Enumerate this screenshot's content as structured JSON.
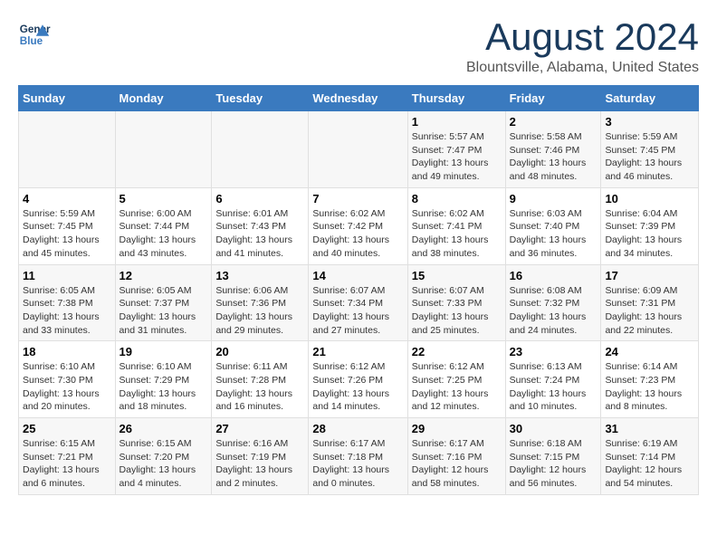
{
  "header": {
    "logo_line1": "General",
    "logo_line2": "Blue",
    "main_title": "August 2024",
    "subtitle": "Blountsville, Alabama, United States"
  },
  "days_of_week": [
    "Sunday",
    "Monday",
    "Tuesday",
    "Wednesday",
    "Thursday",
    "Friday",
    "Saturday"
  ],
  "weeks": [
    [
      {
        "day": "",
        "info": ""
      },
      {
        "day": "",
        "info": ""
      },
      {
        "day": "",
        "info": ""
      },
      {
        "day": "",
        "info": ""
      },
      {
        "day": "1",
        "info": "Sunrise: 5:57 AM\nSunset: 7:47 PM\nDaylight: 13 hours and 49 minutes."
      },
      {
        "day": "2",
        "info": "Sunrise: 5:58 AM\nSunset: 7:46 PM\nDaylight: 13 hours and 48 minutes."
      },
      {
        "day": "3",
        "info": "Sunrise: 5:59 AM\nSunset: 7:45 PM\nDaylight: 13 hours and 46 minutes."
      }
    ],
    [
      {
        "day": "4",
        "info": "Sunrise: 5:59 AM\nSunset: 7:45 PM\nDaylight: 13 hours and 45 minutes."
      },
      {
        "day": "5",
        "info": "Sunrise: 6:00 AM\nSunset: 7:44 PM\nDaylight: 13 hours and 43 minutes."
      },
      {
        "day": "6",
        "info": "Sunrise: 6:01 AM\nSunset: 7:43 PM\nDaylight: 13 hours and 41 minutes."
      },
      {
        "day": "7",
        "info": "Sunrise: 6:02 AM\nSunset: 7:42 PM\nDaylight: 13 hours and 40 minutes."
      },
      {
        "day": "8",
        "info": "Sunrise: 6:02 AM\nSunset: 7:41 PM\nDaylight: 13 hours and 38 minutes."
      },
      {
        "day": "9",
        "info": "Sunrise: 6:03 AM\nSunset: 7:40 PM\nDaylight: 13 hours and 36 minutes."
      },
      {
        "day": "10",
        "info": "Sunrise: 6:04 AM\nSunset: 7:39 PM\nDaylight: 13 hours and 34 minutes."
      }
    ],
    [
      {
        "day": "11",
        "info": "Sunrise: 6:05 AM\nSunset: 7:38 PM\nDaylight: 13 hours and 33 minutes."
      },
      {
        "day": "12",
        "info": "Sunrise: 6:05 AM\nSunset: 7:37 PM\nDaylight: 13 hours and 31 minutes."
      },
      {
        "day": "13",
        "info": "Sunrise: 6:06 AM\nSunset: 7:36 PM\nDaylight: 13 hours and 29 minutes."
      },
      {
        "day": "14",
        "info": "Sunrise: 6:07 AM\nSunset: 7:34 PM\nDaylight: 13 hours and 27 minutes."
      },
      {
        "day": "15",
        "info": "Sunrise: 6:07 AM\nSunset: 7:33 PM\nDaylight: 13 hours and 25 minutes."
      },
      {
        "day": "16",
        "info": "Sunrise: 6:08 AM\nSunset: 7:32 PM\nDaylight: 13 hours and 24 minutes."
      },
      {
        "day": "17",
        "info": "Sunrise: 6:09 AM\nSunset: 7:31 PM\nDaylight: 13 hours and 22 minutes."
      }
    ],
    [
      {
        "day": "18",
        "info": "Sunrise: 6:10 AM\nSunset: 7:30 PM\nDaylight: 13 hours and 20 minutes."
      },
      {
        "day": "19",
        "info": "Sunrise: 6:10 AM\nSunset: 7:29 PM\nDaylight: 13 hours and 18 minutes."
      },
      {
        "day": "20",
        "info": "Sunrise: 6:11 AM\nSunset: 7:28 PM\nDaylight: 13 hours and 16 minutes."
      },
      {
        "day": "21",
        "info": "Sunrise: 6:12 AM\nSunset: 7:26 PM\nDaylight: 13 hours and 14 minutes."
      },
      {
        "day": "22",
        "info": "Sunrise: 6:12 AM\nSunset: 7:25 PM\nDaylight: 13 hours and 12 minutes."
      },
      {
        "day": "23",
        "info": "Sunrise: 6:13 AM\nSunset: 7:24 PM\nDaylight: 13 hours and 10 minutes."
      },
      {
        "day": "24",
        "info": "Sunrise: 6:14 AM\nSunset: 7:23 PM\nDaylight: 13 hours and 8 minutes."
      }
    ],
    [
      {
        "day": "25",
        "info": "Sunrise: 6:15 AM\nSunset: 7:21 PM\nDaylight: 13 hours and 6 minutes."
      },
      {
        "day": "26",
        "info": "Sunrise: 6:15 AM\nSunset: 7:20 PM\nDaylight: 13 hours and 4 minutes."
      },
      {
        "day": "27",
        "info": "Sunrise: 6:16 AM\nSunset: 7:19 PM\nDaylight: 13 hours and 2 minutes."
      },
      {
        "day": "28",
        "info": "Sunrise: 6:17 AM\nSunset: 7:18 PM\nDaylight: 13 hours and 0 minutes."
      },
      {
        "day": "29",
        "info": "Sunrise: 6:17 AM\nSunset: 7:16 PM\nDaylight: 12 hours and 58 minutes."
      },
      {
        "day": "30",
        "info": "Sunrise: 6:18 AM\nSunset: 7:15 PM\nDaylight: 12 hours and 56 minutes."
      },
      {
        "day": "31",
        "info": "Sunrise: 6:19 AM\nSunset: 7:14 PM\nDaylight: 12 hours and 54 minutes."
      }
    ]
  ]
}
